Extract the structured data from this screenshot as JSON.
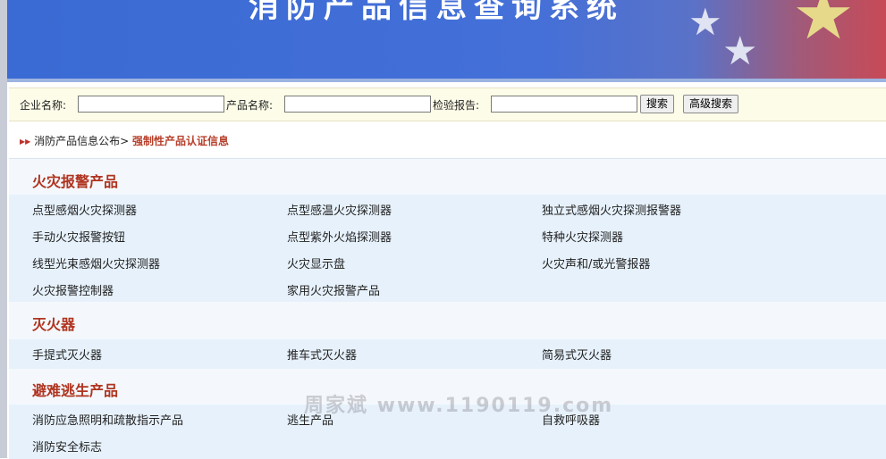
{
  "banner": {
    "title": "消防产品信息查询系统"
  },
  "search": {
    "company_label": "企业名称:",
    "company_value": "",
    "product_label": "产品名称:",
    "product_value": "",
    "report_label": "检验报告:",
    "report_value": "",
    "search_button": "搜索",
    "advanced_button": "高级搜索"
  },
  "breadcrumb": {
    "arrows": "▶▶",
    "parent": "消防产品信息公布>",
    "current": "强制性产品认证信息"
  },
  "categories": [
    {
      "title": "火灾报警产品",
      "items": [
        "点型感烟火灾探测器",
        "点型感温火灾探测器",
        "独立式感烟火灾探测报警器",
        "手动火灾报警按钮",
        "点型紫外火焰探测器",
        "特种火灾探测器",
        "线型光束感烟火灾探测器",
        "火灾显示盘",
        "火灾声和/或光警报器",
        "火灾报警控制器",
        "家用火灾报警产品"
      ]
    },
    {
      "title": "灭火器",
      "items": [
        "手提式灭火器",
        "推车式灭火器",
        "简易式灭火器"
      ]
    },
    {
      "title": "避难逃生产品",
      "items": [
        "消防应急照明和疏散指示产品",
        "逃生产品",
        "自救呼吸器",
        "消防安全标志"
      ]
    }
  ],
  "watermark": "周家斌  www.1190119.com"
}
